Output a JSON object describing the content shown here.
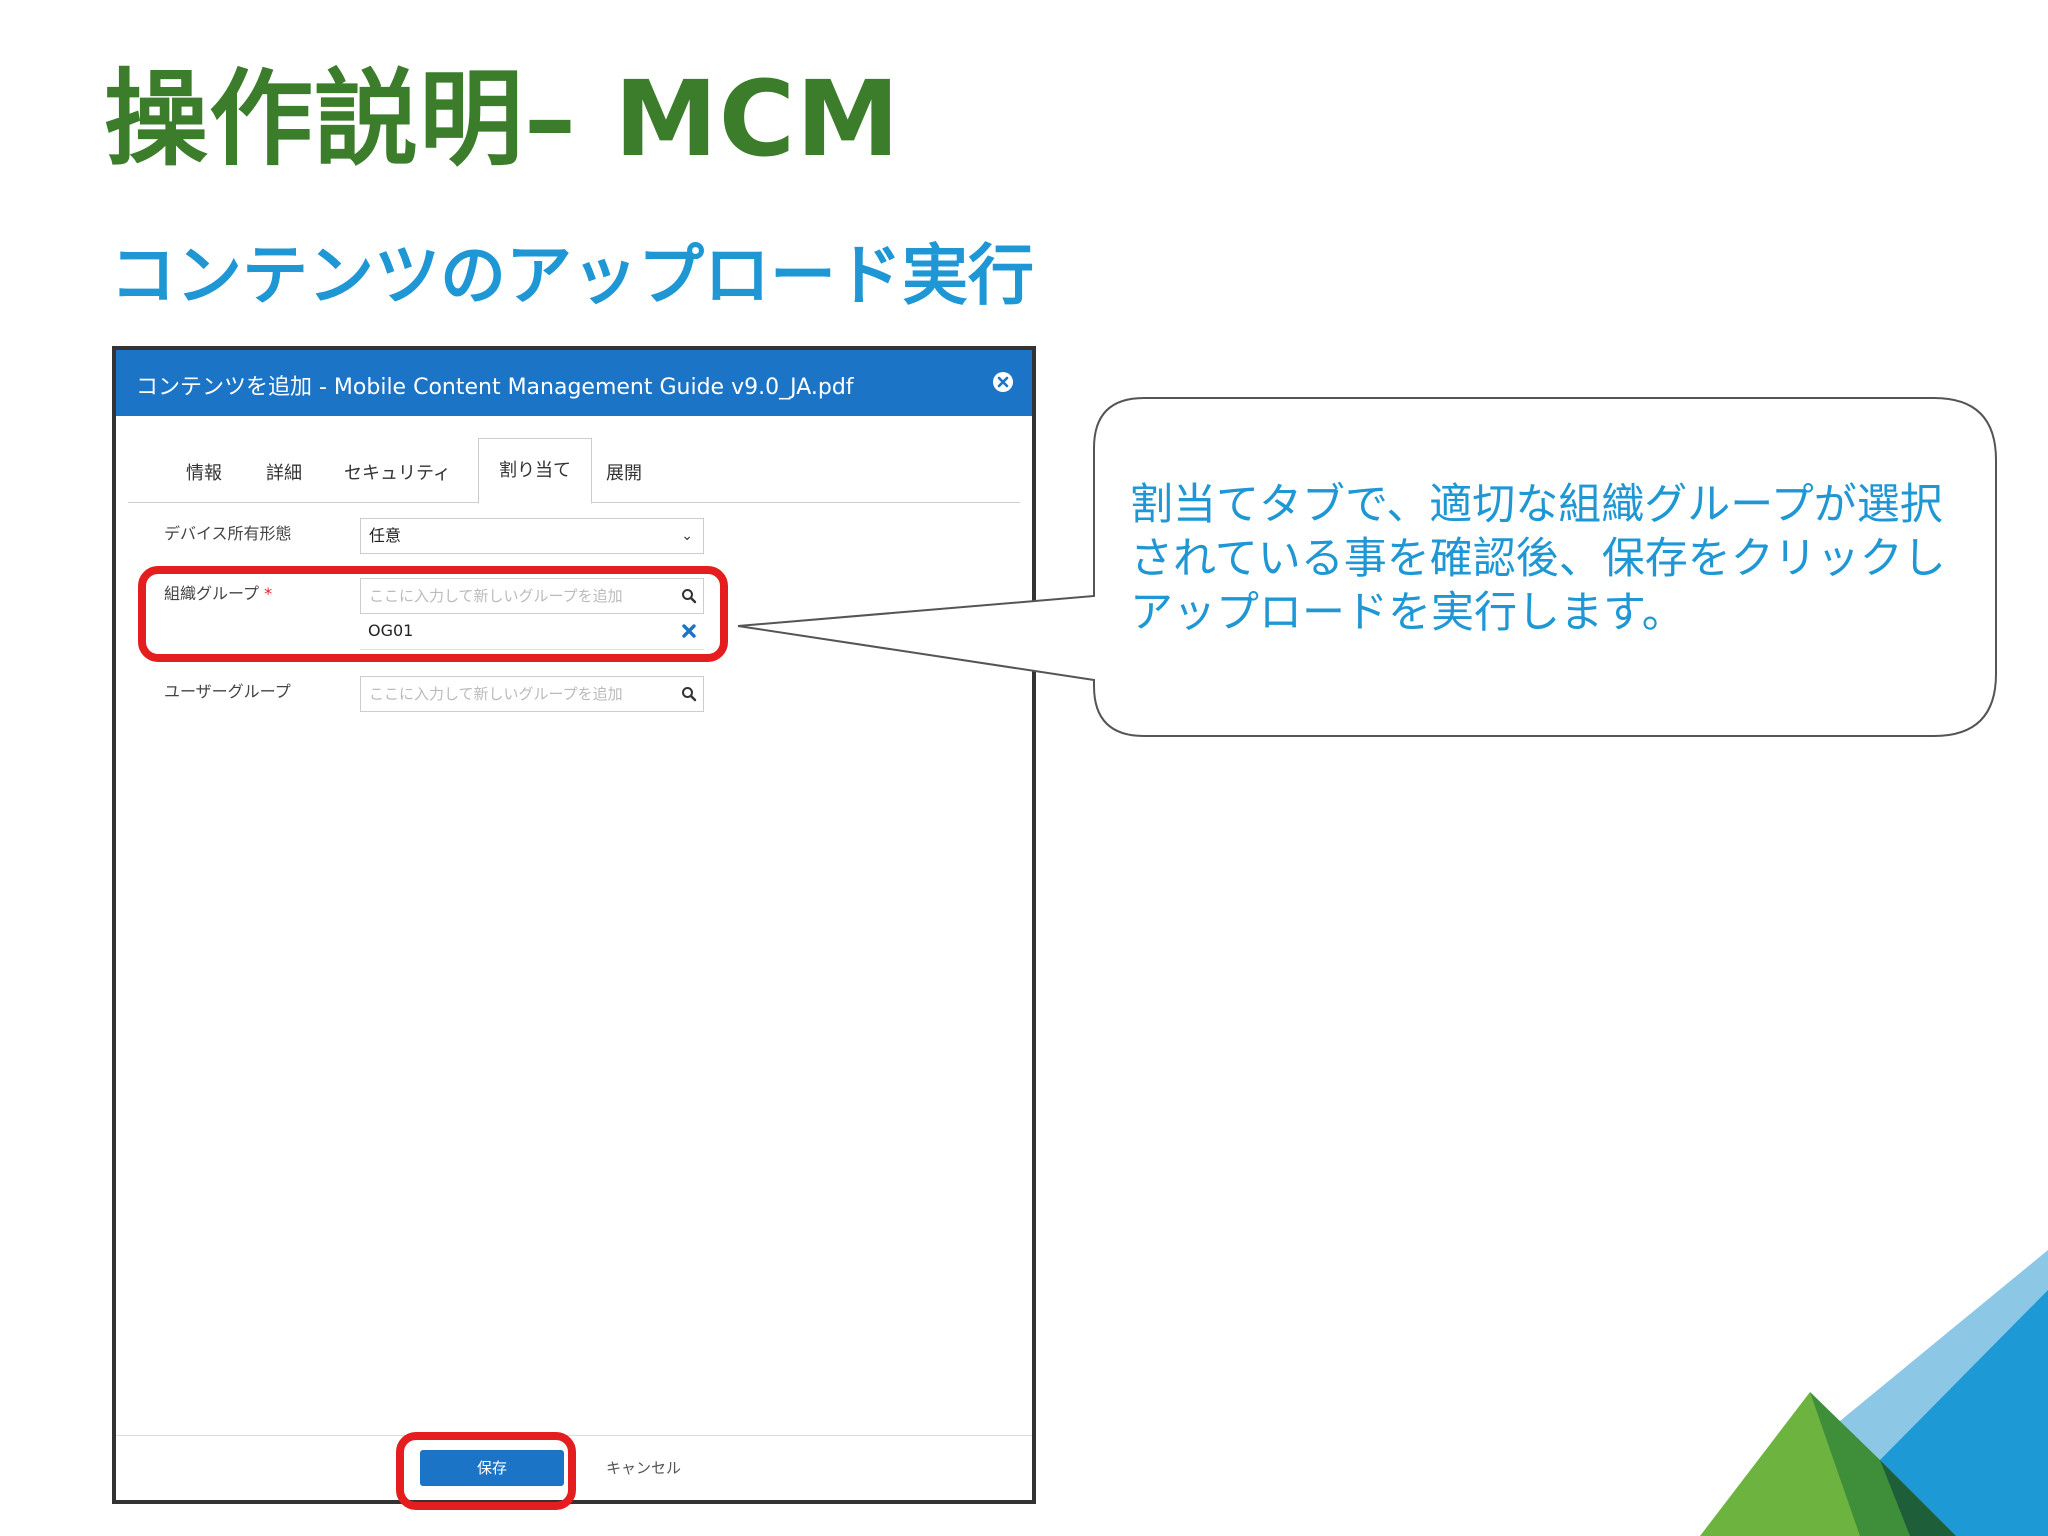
{
  "slide": {
    "title": "操作説明– MCM",
    "subtitle": "コンテンツのアップロード実行"
  },
  "dialog": {
    "title": "コンテンツを追加 - Mobile Content Management Guide v9.0_JA.pdf",
    "tabs": [
      {
        "label": "情報"
      },
      {
        "label": "詳細"
      },
      {
        "label": "セキュリティ"
      },
      {
        "label": "割り当て",
        "active": true
      },
      {
        "label": "展開"
      }
    ],
    "ownership": {
      "label": "デバイス所有形態",
      "value": "任意"
    },
    "org_group": {
      "label": "組織グループ",
      "required_mark": "*",
      "placeholder": "ここに入力して新しいグループを追加",
      "selected": "OG01"
    },
    "user_group": {
      "label": "ユーザーグループ",
      "placeholder": "ここに入力して新しいグループを追加"
    },
    "footer": {
      "save_label": "保存",
      "cancel_label": "キャンセル"
    }
  },
  "callout": {
    "text": "割当てタブで、適切な組織グループが選択されている事を確認後、保存をクリックしアップロードを実行します。"
  },
  "colors": {
    "title_green": "#3b7d2a",
    "subtitle_blue": "#1f97d4",
    "dialog_blue": "#1b74c6",
    "highlight_red": "#e41e1e"
  }
}
